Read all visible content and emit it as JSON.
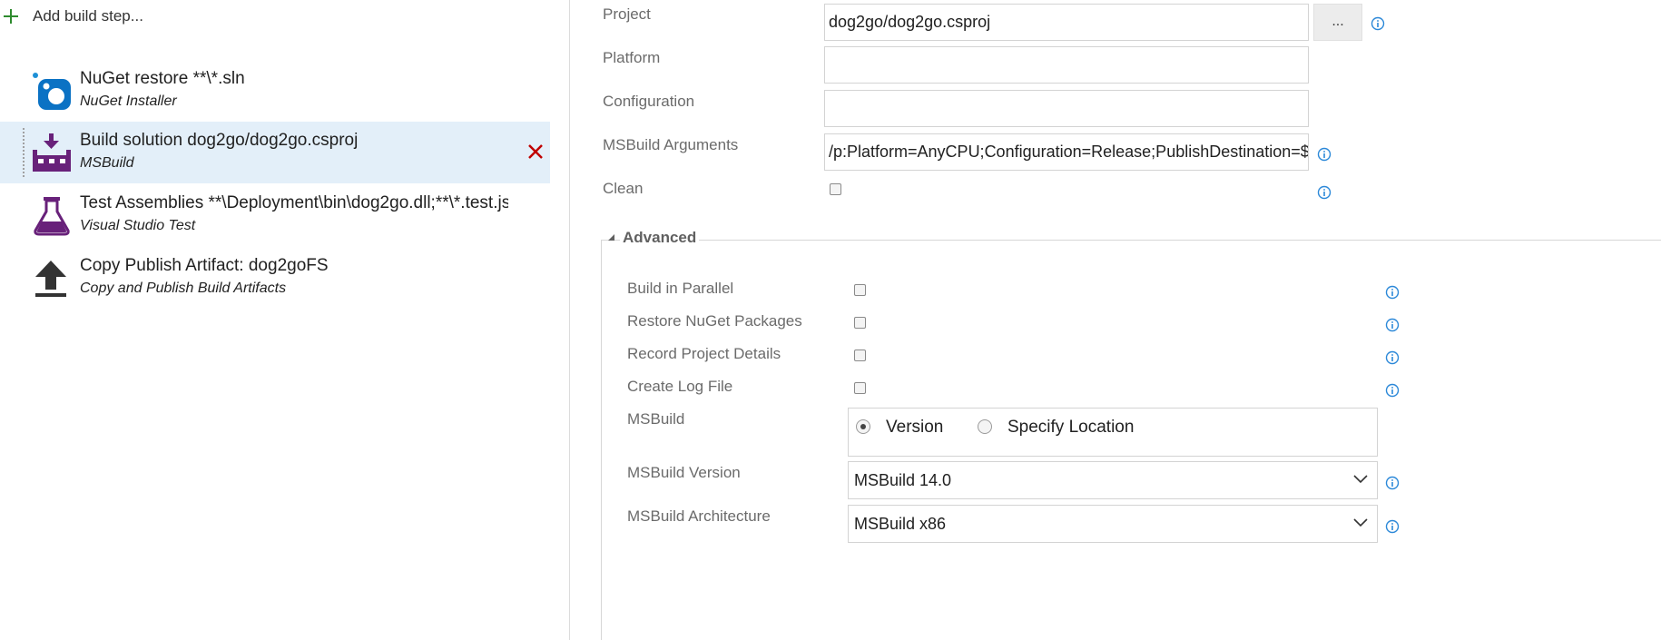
{
  "left": {
    "add_step_label": "Add build step...",
    "steps": [
      {
        "title": "NuGet restore **\\*.sln",
        "subtitle": "NuGet Installer",
        "icon": "nuget-icon"
      },
      {
        "title": "Build solution dog2go/dog2go.csproj",
        "subtitle": "MSBuild",
        "icon": "msbuild-icon",
        "selected": true
      },
      {
        "title": "Test Assemblies **\\Deployment\\bin\\dog2go.dll;**\\*.test.js",
        "subtitle": "Visual Studio Test",
        "icon": "flask-icon"
      },
      {
        "title": "Copy Publish Artifact: dog2goFS",
        "subtitle": "Copy and Publish Build Artifacts",
        "icon": "upload-icon"
      }
    ]
  },
  "form": {
    "project": {
      "label": "Project",
      "value": "dog2go/dog2go.csproj",
      "browse_label": "..."
    },
    "platform": {
      "label": "Platform",
      "value": ""
    },
    "configuration": {
      "label": "Configuration",
      "value": ""
    },
    "msbuild_arguments": {
      "label": "MSBuild Arguments",
      "value": "/p:Platform=AnyCPU;Configuration=Release;PublishDestination=$(Build.ArtifactStagingDirectory)"
    },
    "clean": {
      "label": "Clean",
      "checked": false
    }
  },
  "advanced": {
    "title": "Advanced",
    "build_in_parallel": {
      "label": "Build in Parallel",
      "checked": false
    },
    "restore_nuget_packages": {
      "label": "Restore NuGet Packages",
      "checked": false
    },
    "record_project_details": {
      "label": "Record Project Details",
      "checked": false
    },
    "create_log_file": {
      "label": "Create Log File",
      "checked": false
    },
    "msbuild": {
      "label": "MSBuild",
      "options": [
        "Version",
        "Specify Location"
      ],
      "selected": "Version"
    },
    "msbuild_version": {
      "label": "MSBuild Version",
      "value": "MSBuild 14.0"
    },
    "msbuild_architecture": {
      "label": "MSBuild Architecture",
      "value": "MSBuild x86"
    }
  },
  "colors": {
    "selected_row": "#e3eff9",
    "info_icon": "#2b88d8",
    "delete": "#c00000",
    "add": "#2e8b2e",
    "vs_purple": "#68217a"
  }
}
